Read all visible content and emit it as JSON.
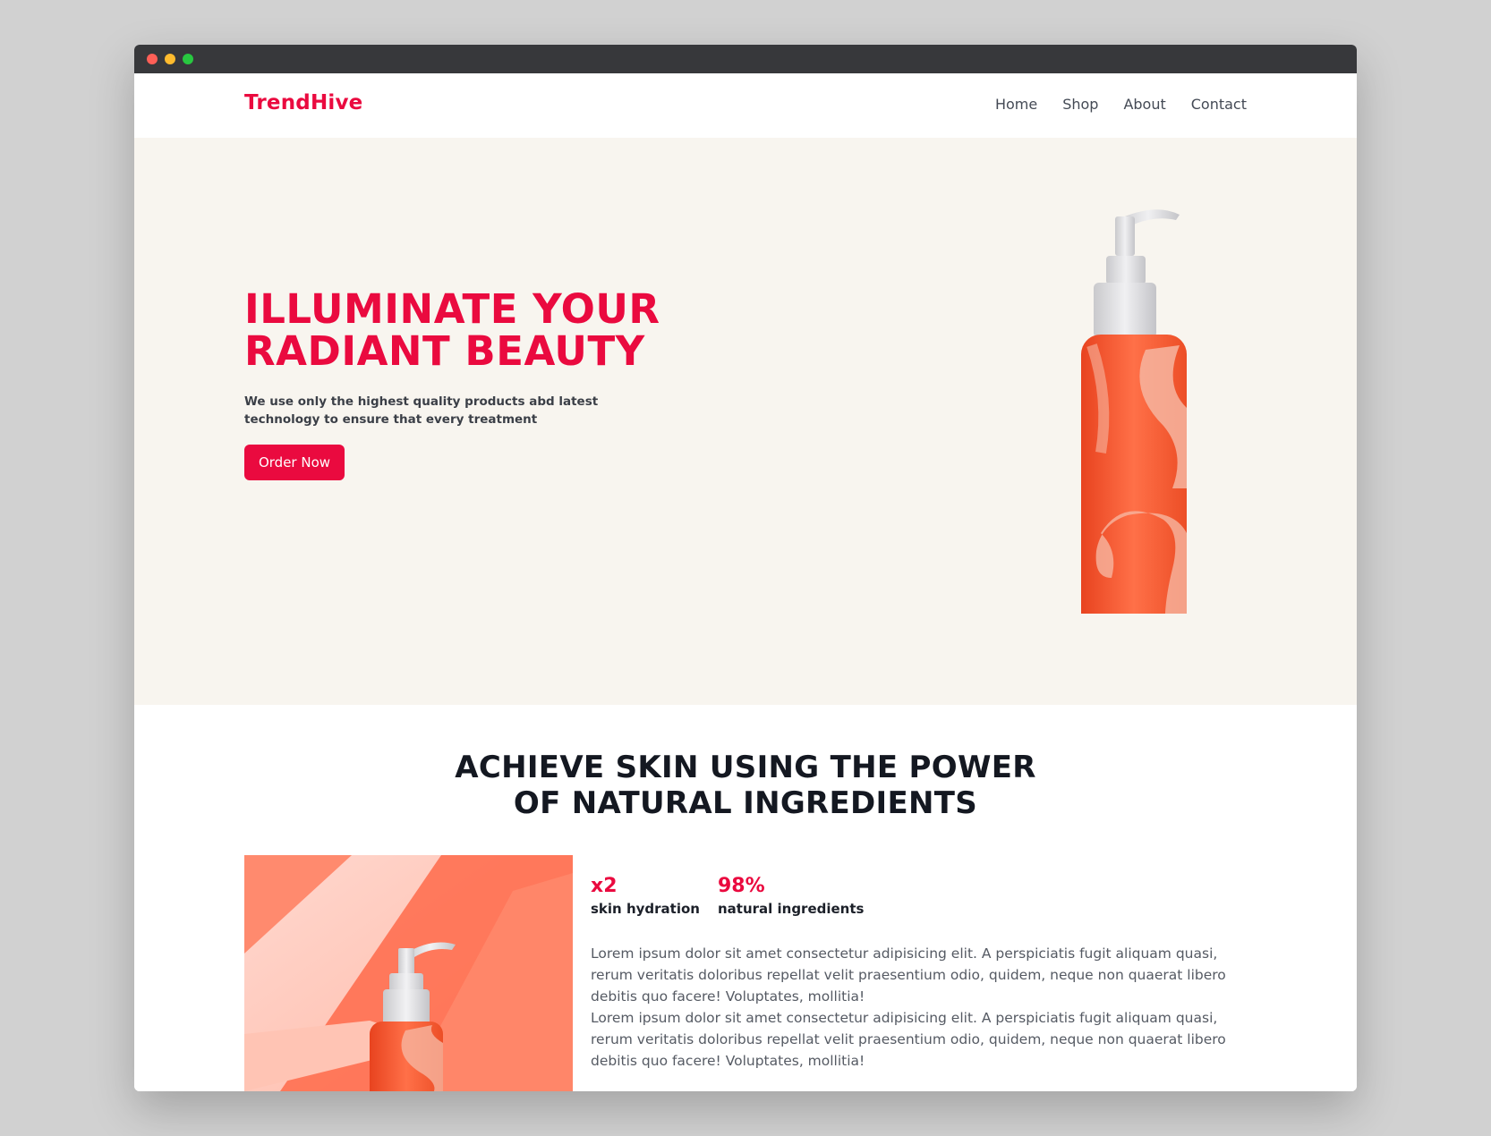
{
  "brand": {
    "name": "TrendHive",
    "accent": "#ea0a3f"
  },
  "nav": {
    "items": [
      "Home",
      "Shop",
      "About",
      "Contact"
    ]
  },
  "hero": {
    "title_line1": "ILLUMINATE YOUR",
    "title_line2": "RADIANT BEAUTY",
    "subtitle": "We use only the highest quality products abd latest technology to ensure that every treatment",
    "cta_label": "Order Now"
  },
  "feature": {
    "title_line1": "ACHIEVE SKIN USING THE POWER",
    "title_line2": "OF NATURAL INGREDIENTS",
    "stats": [
      {
        "value": "x2",
        "label": "skin hydration"
      },
      {
        "value": "98%",
        "label": "natural ingredients"
      }
    ],
    "paragraphs": [
      "Lorem ipsum dolor sit amet consectetur adipisicing elit. A perspiciatis fugit aliquam quasi, rerum veritatis doloribus repellat velit praesentium odio, quidem, neque non quaerat libero debitis quo facere! Voluptates, mollitia!",
      "Lorem ipsum dolor sit amet consectetur adipisicing elit. A perspiciatis fugit aliquam quasi, rerum veritatis doloribus repellat velit praesentium odio, quidem, neque non quaerat libero debitis quo facere! Voluptates, mollitia!"
    ]
  }
}
